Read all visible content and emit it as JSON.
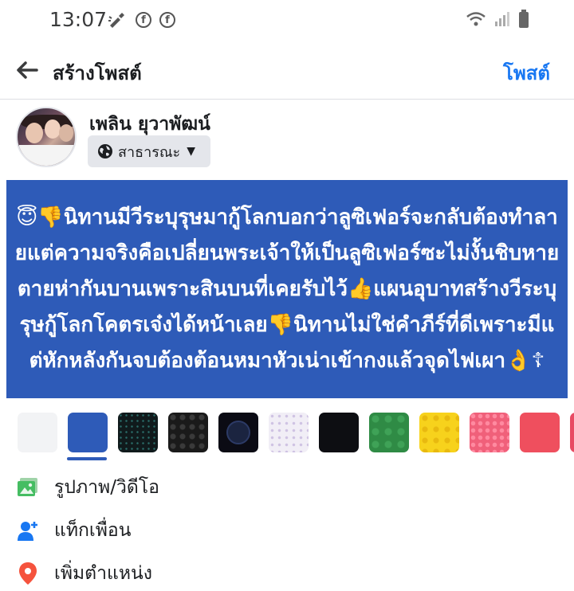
{
  "status_bar": {
    "time": "13:07"
  },
  "header": {
    "title": "สร้างโพสต์",
    "post_label": "โพสต์"
  },
  "profile": {
    "name": "เพลิน ยุวาพัฒน์",
    "privacy": "สาธารณะ"
  },
  "post": {
    "text": "😇👎นิทานมีวีระบุรุษมากู้โลกบอกว่าลูซิเฟอร์จะกลับต้องทำลายแต่ความจริงคือเปลี่ยนพระเจ้าให้เป็นลูซิเฟอร์ซะไม่งั้นชิบหายตายห่ากันบานเพราะสินบนที่เคยรับไว้👍แผนอุบาทสร้างวีระบุรุษกู้โลกโคตรเจ๋งได้หน้าเลย👎นิทานไม่ใช่คำภีร์ที่ดีเพราะมีแต่หักหลังกันจบต้องต้อนหมาหัวเน่าเข้ากงแล้วจุดไฟเผา👌☦",
    "background_color": "#2e5bb8"
  },
  "backgrounds": [
    {
      "name": "white",
      "color": "#f2f3f5"
    },
    {
      "name": "blue",
      "color": "#2e5bb8",
      "selected": true
    },
    {
      "name": "dark-dots",
      "color": "#101a1c"
    },
    {
      "name": "dark-hearts",
      "color": "#1a1a1a"
    },
    {
      "name": "vinyl",
      "color": "#0b0b14"
    },
    {
      "name": "light-pattern",
      "color": "#f1eef6"
    },
    {
      "name": "night",
      "color": "#0d0e12"
    },
    {
      "name": "green",
      "color": "#2f8b45"
    },
    {
      "name": "yellow",
      "color": "#f7d21c"
    },
    {
      "name": "pink-hearts",
      "color": "#f0607a"
    },
    {
      "name": "red",
      "color": "#ef4f5e"
    },
    {
      "name": "more",
      "color": "#e84b63"
    }
  ],
  "actions": [
    {
      "icon": "photo-icon",
      "label": "รูปภาพ/วิดีโอ"
    },
    {
      "icon": "tag-friend-icon",
      "label": "แท็กเพื่อน"
    },
    {
      "icon": "location-icon",
      "label": "เพิ่มตำแหน่ง"
    }
  ]
}
